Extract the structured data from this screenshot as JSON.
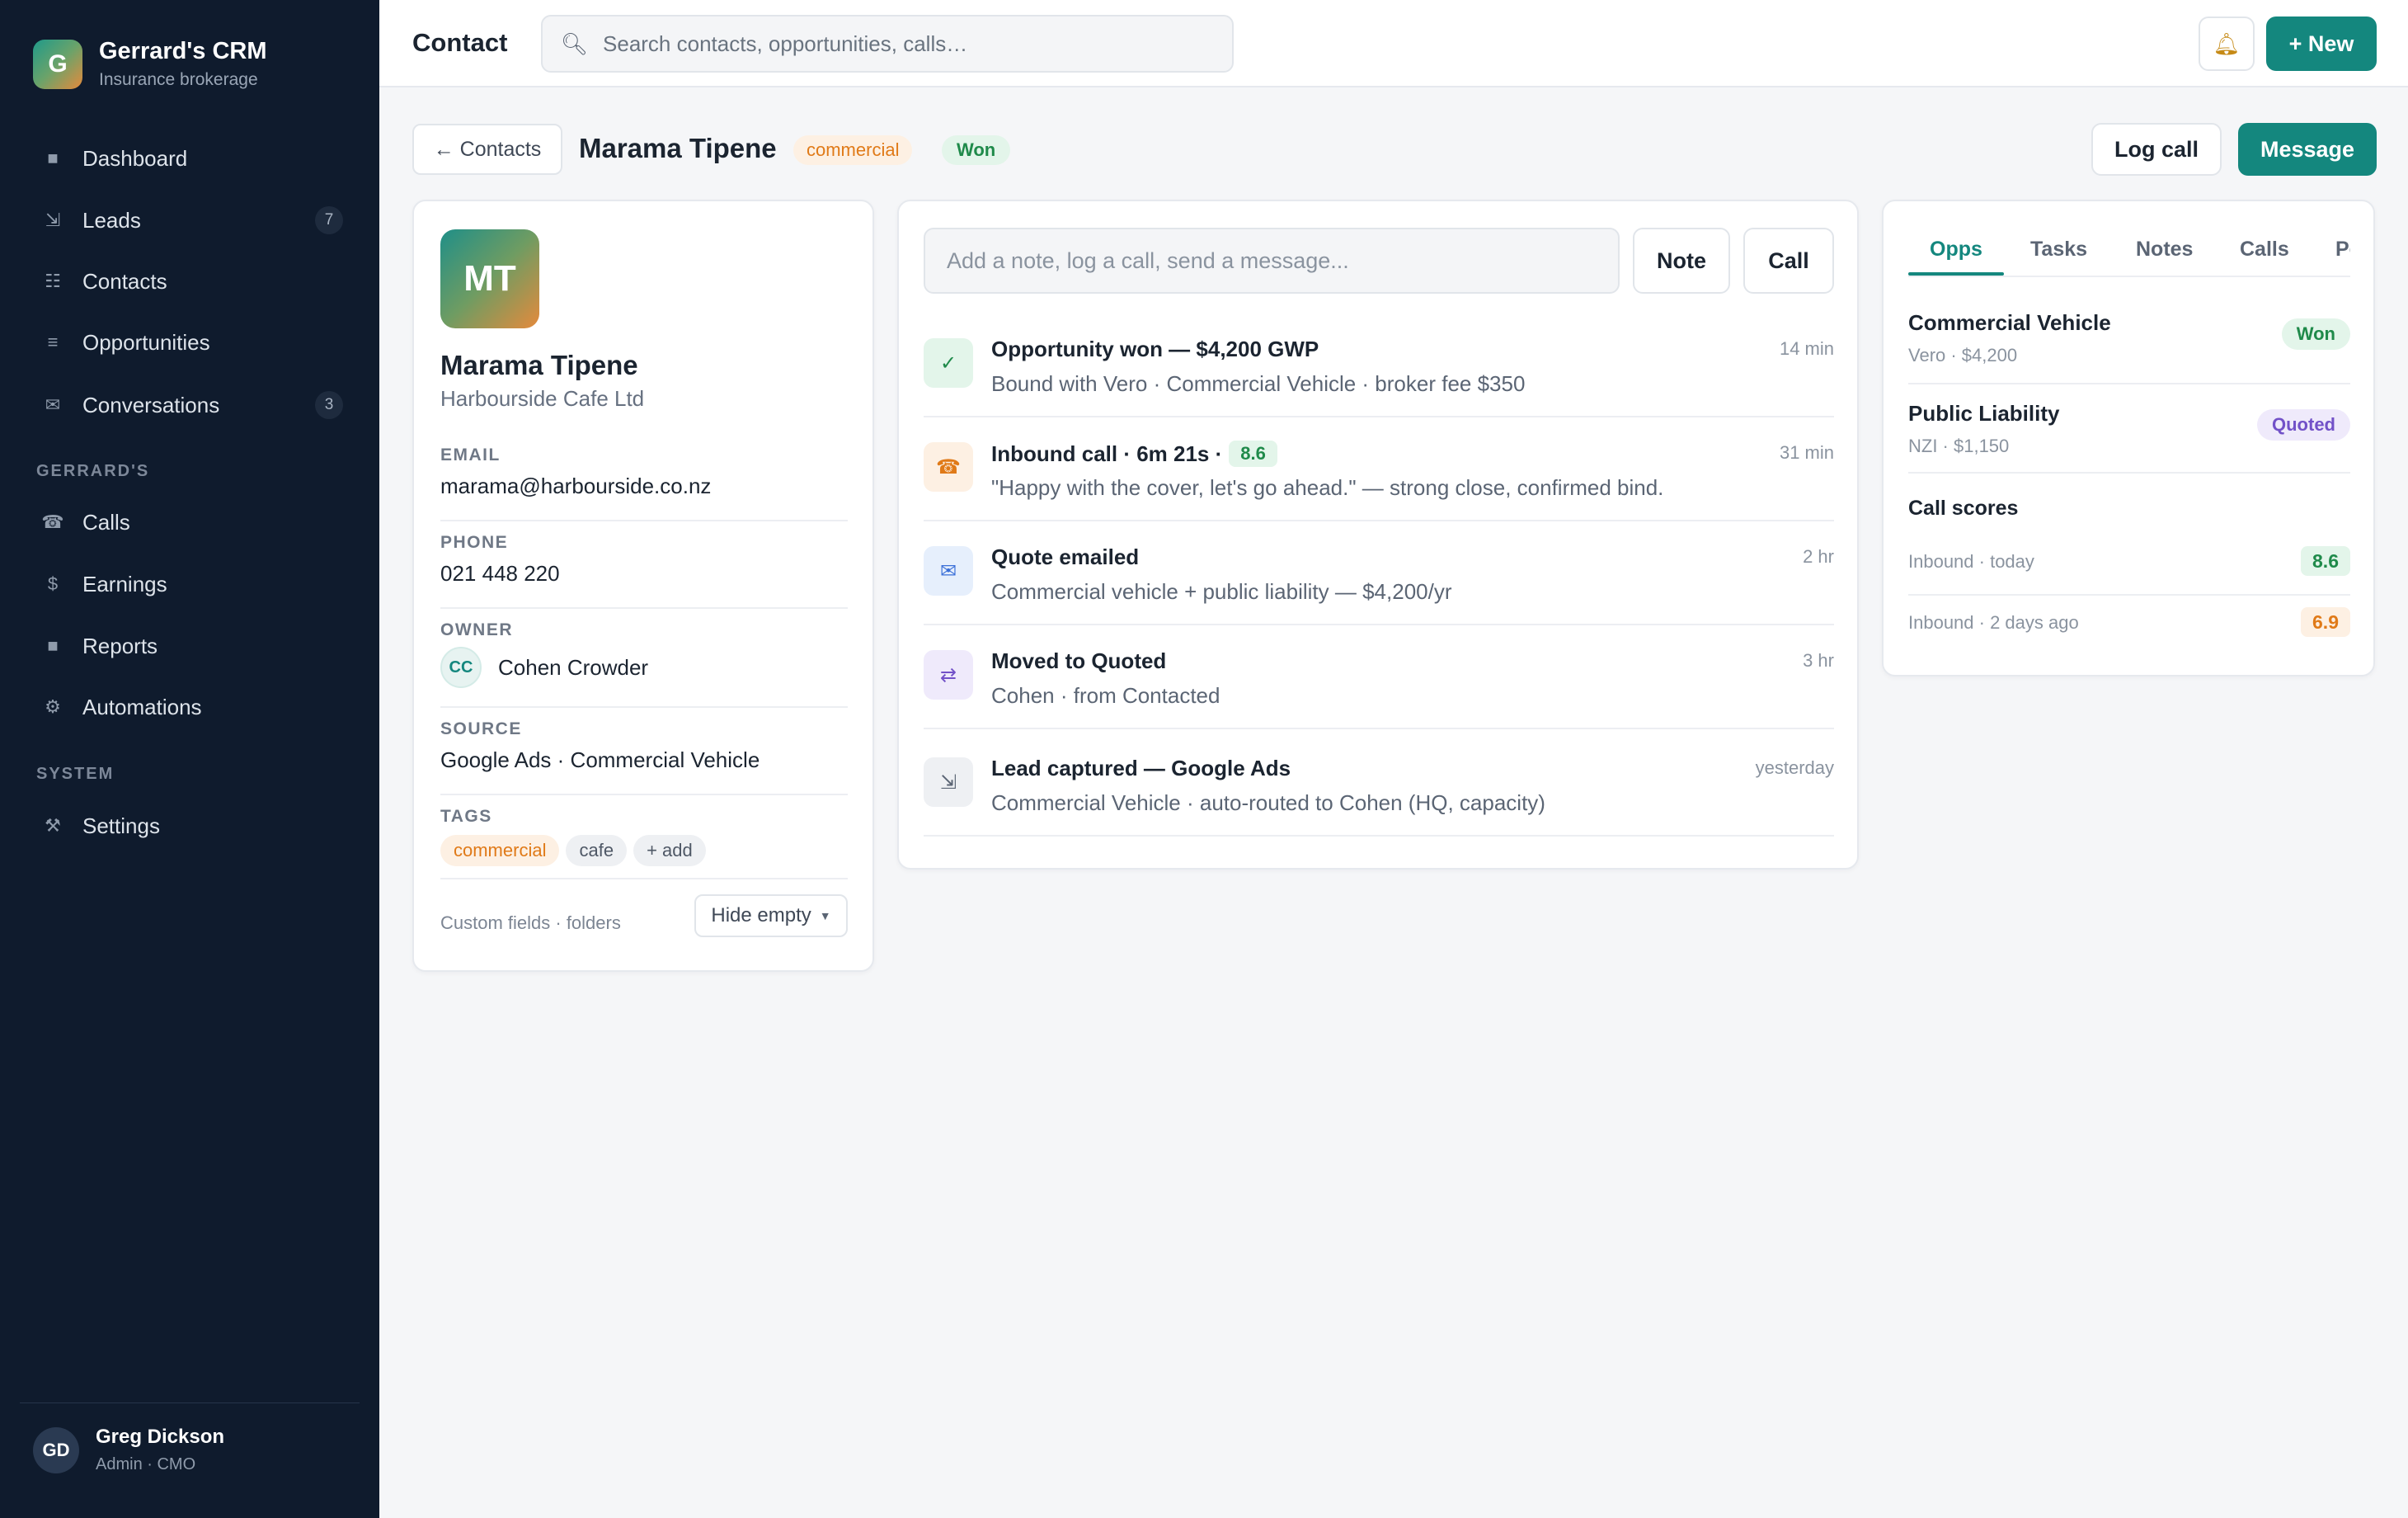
{
  "brand": {
    "initial": "G",
    "title": "Gerrard's CRM",
    "subtitle": "Insurance brokerage"
  },
  "nav": {
    "main": [
      {
        "label": "Dashboard",
        "icon": "dashboard-icon",
        "glyph": "■"
      },
      {
        "label": "Leads",
        "icon": "leads-icon",
        "glyph": "⇲",
        "badge": "7"
      },
      {
        "label": "Contacts",
        "icon": "contacts-icon",
        "glyph": "☷"
      },
      {
        "label": "Opportunities",
        "icon": "opportunities-icon",
        "glyph": "≡"
      },
      {
        "label": "Conversations",
        "icon": "conversations-icon",
        "glyph": "✉",
        "badge": "3"
      }
    ],
    "section_gerrards": "GERRARD'S",
    "gerrards": [
      {
        "label": "Calls",
        "icon": "phone-icon",
        "glyph": "☎"
      },
      {
        "label": "Earnings",
        "icon": "dollar-icon",
        "glyph": "$"
      },
      {
        "label": "Reports",
        "icon": "reports-icon",
        "glyph": "■"
      },
      {
        "label": "Automations",
        "icon": "automations-icon",
        "glyph": "⚙"
      }
    ],
    "section_system": "SYSTEM",
    "system": [
      {
        "label": "Settings",
        "icon": "settings-icon",
        "glyph": "⚒"
      }
    ]
  },
  "user": {
    "initials": "GD",
    "name": "Greg Dickson",
    "role": "Admin · CMO"
  },
  "topbar": {
    "title": "Contact",
    "search_placeholder": "Search contacts, opportunities, calls…",
    "new_label": "+ New"
  },
  "header": {
    "back_label": "← Contacts",
    "name": "Marama Tipene",
    "tag": "commercial",
    "status": "Won",
    "log_call_label": "Log call",
    "message_label": "Message"
  },
  "contact": {
    "initials": "MT",
    "name": "Marama Tipene",
    "company": "Harbourside Cafe Ltd",
    "email_label": "EMAIL",
    "email": "marama@harbourside.co.nz",
    "phone_label": "PHONE",
    "phone": "021 448 220",
    "owner_label": "OWNER",
    "owner_initials": "CC",
    "owner_name": "Cohen Crowder",
    "source_label": "SOURCE",
    "source": "Google Ads · Commercial Vehicle",
    "tags_label": "TAGS",
    "tags": [
      "commercial",
      "cafe",
      "+ add"
    ],
    "footer_text": "Custom fields · folders",
    "hide_empty_label": "Hide empty"
  },
  "composer": {
    "placeholder": "Add a note, log a call, send a message...",
    "note_label": "Note",
    "call_label": "Call"
  },
  "activity": [
    {
      "title": "Opportunity won — $4,200 GWP",
      "sub": "Bound with Vero · Commercial Vehicle · broker fee $350",
      "time": "14 min",
      "icon": "check-icon",
      "glyph": "✓",
      "bg": "#e3f5ea",
      "fg": "#1f8a4a"
    },
    {
      "title": "Inbound call · 6m 21s ·",
      "score": "8.6",
      "sub": "\"Happy with the cover, let's go ahead.\" — strong close, confirmed bind.",
      "time": "31 min",
      "icon": "phone-icon",
      "glyph": "☎",
      "bg": "#fdf0e3",
      "fg": "#e07a18"
    },
    {
      "title": "Quote emailed",
      "sub": "Commercial vehicle + public liability — $4,200/yr",
      "time": "2 hr",
      "icon": "mail-icon",
      "glyph": "✉",
      "bg": "#e6effc",
      "fg": "#3a6fd8"
    },
    {
      "title": "Moved to Quoted",
      "sub": "Cohen · from Contacted",
      "time": "3 hr",
      "icon": "swap-icon",
      "glyph": "⇄",
      "bg": "#efeafb",
      "fg": "#7251c8"
    },
    {
      "title": "Lead captured — Google Ads",
      "sub": "Commercial Vehicle · auto-routed to Cohen (HQ, capacity)",
      "time": "yesterday",
      "icon": "lead-capture-icon",
      "glyph": "⇲",
      "bg": "#eef0f3",
      "fg": "#5b6574"
    }
  ],
  "right_panel": {
    "tabs": [
      "Opps",
      "Tasks",
      "Notes",
      "Calls",
      "Policies"
    ],
    "active_tab": "Opps",
    "opportunities": [
      {
        "name": "Commercial Vehicle",
        "sub": "Vero · $4,200",
        "status": "Won"
      },
      {
        "name": "Public Liability",
        "sub": "NZI · $1,150",
        "status": "Quoted"
      }
    ],
    "call_scores_title": "Call scores",
    "call_scores": [
      {
        "label": "Inbound · today",
        "score": "8.6"
      },
      {
        "label": "Inbound · 2 days ago",
        "score": "6.9"
      }
    ]
  },
  "colors": {
    "accent": "#14877e",
    "sidebar": "#0f1b2d",
    "won": "#1f8a4a",
    "quoted": "#7251c8",
    "commercial": "#e07a18"
  }
}
